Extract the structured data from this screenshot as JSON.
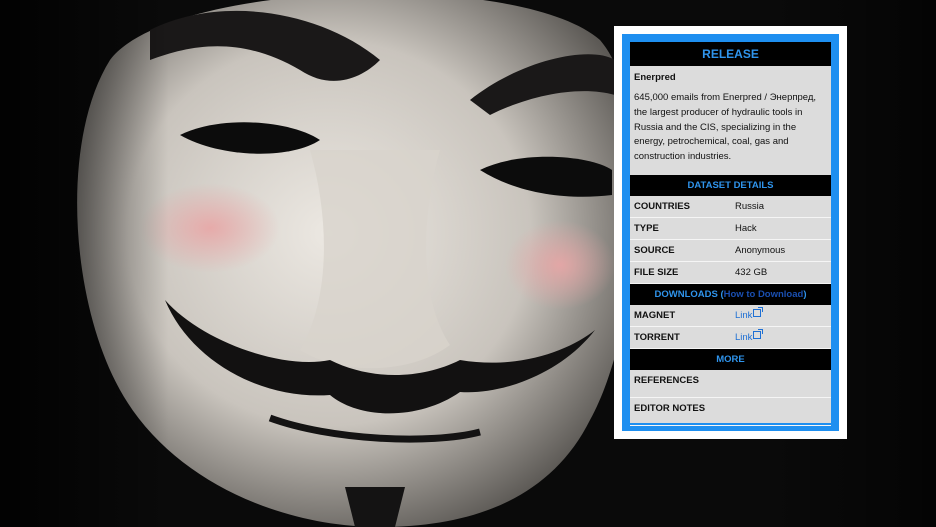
{
  "card": {
    "header": "RELEASE",
    "name": "Enerpred",
    "description": "645,000 emails from Enerpred / Энерпред, the largest producer of hydraulic tools in Russia and the CIS, specializing in the energy, petrochemical, coal, gas and construction industries.",
    "dataset_header": "DATASET DETAILS",
    "details": [
      {
        "key": "COUNTRIES",
        "value": "Russia"
      },
      {
        "key": "TYPE",
        "value": "Hack"
      },
      {
        "key": "SOURCE",
        "value": "Anonymous"
      },
      {
        "key": "FILE SIZE",
        "value": "432 GB"
      }
    ],
    "downloads_header": "DOWNLOADS",
    "downloads_open": "(",
    "downloads_howto": "How to Download",
    "downloads_close": ")",
    "downloads": [
      {
        "key": "MAGNET",
        "link": "Link"
      },
      {
        "key": "TORRENT",
        "link": "Link"
      }
    ],
    "more_header": "MORE",
    "more_items": [
      "REFERENCES",
      "EDITOR NOTES"
    ]
  },
  "colors": {
    "accent_blue": "#1e8ff0",
    "header_text": "#2f94ec",
    "link": "#1d6fd4",
    "card_bg": "#dcdcdc"
  },
  "image": {
    "subject": "guy-fawkes-mask-photo"
  }
}
